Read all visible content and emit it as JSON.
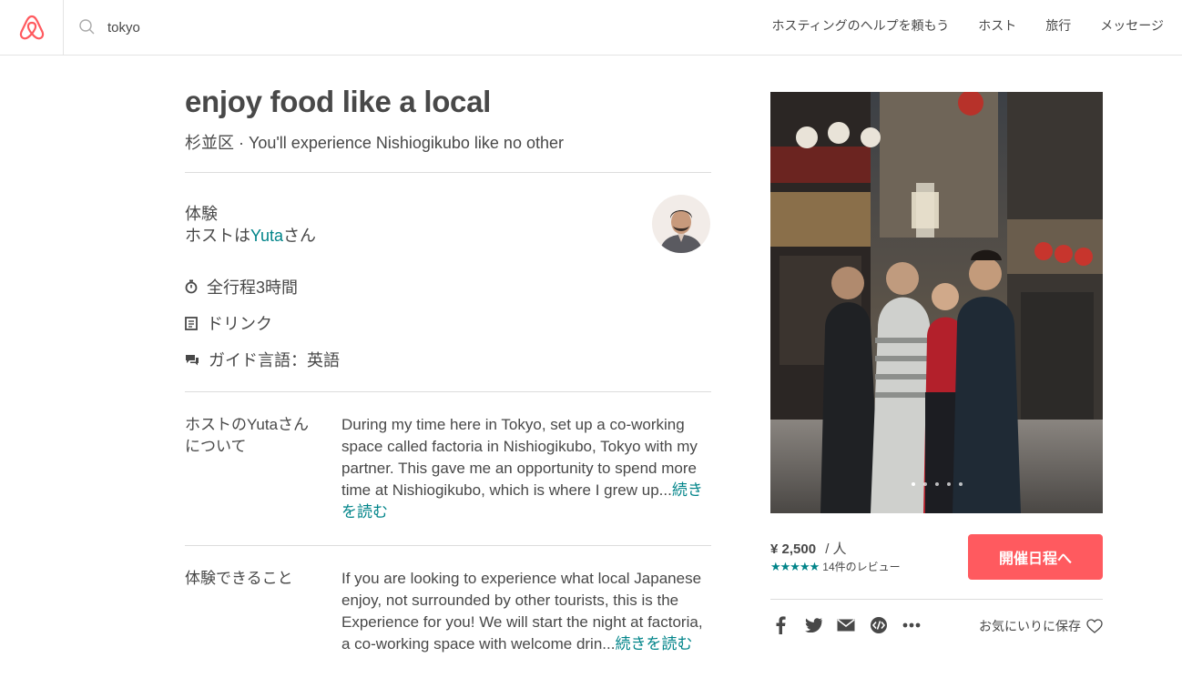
{
  "header": {
    "search_value": "tokyo",
    "nav": [
      "ホスティングのヘルプを頼もう",
      "ホスト",
      "旅行",
      "メッセージ"
    ]
  },
  "experience": {
    "title": "enjoy food like a local",
    "subtitle": "杉並区 · You'll experience Nishiogikubo like no other",
    "type_label": "体験",
    "host_prefix": "ホストは",
    "host_name": "Yuta",
    "host_suffix": "さん",
    "features": [
      {
        "icon": "clock-icon",
        "label": "全行程3時間"
      },
      {
        "icon": "drink-icon",
        "label": "ドリンク"
      },
      {
        "icon": "chat-icon",
        "label": "ガイド言語：英語"
      }
    ]
  },
  "about_host": {
    "label": "ホストのYutaさんについて",
    "body": "During my time here in Tokyo, set up a co-working space called factoria in Nishiogikubo, Tokyo with my partner. This gave me an opportunity to spend more time at Nishiogikubo, which is where I grew up...",
    "read_more": "続きを読む"
  },
  "what_youll_do": {
    "label": "体験できること",
    "body": "If you are looking to experience what local Japanese enjoy, not surrounded by other tourists, this is the Experience for you! We will start the night at factoria, a co-working space with welcome drin...",
    "read_more": "続きを読む"
  },
  "booking": {
    "price": "¥ 2,500",
    "per": "/ 人",
    "stars": "★★★★★",
    "reviews": "14件のレビュー",
    "book_label": "開催日程へ",
    "save_label": "お気にいりに保存"
  },
  "colors": {
    "brand": "#ff5a5f",
    "link": "#008489",
    "text": "#484848"
  }
}
